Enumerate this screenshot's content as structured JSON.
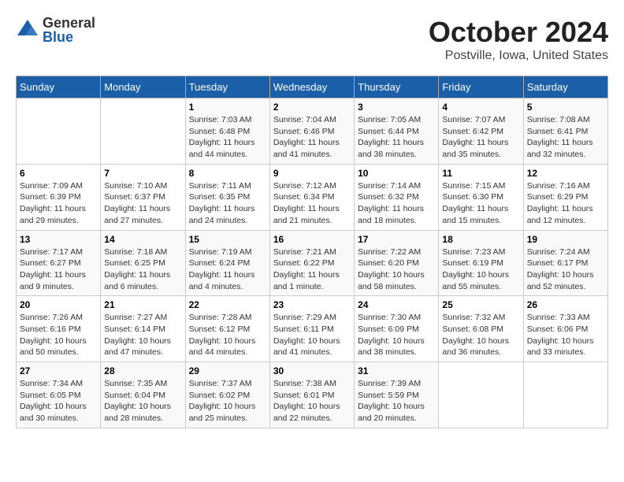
{
  "logo": {
    "general": "General",
    "blue": "Blue"
  },
  "title": "October 2024",
  "location": "Postville, Iowa, United States",
  "headers": [
    "Sunday",
    "Monday",
    "Tuesday",
    "Wednesday",
    "Thursday",
    "Friday",
    "Saturday"
  ],
  "weeks": [
    [
      {
        "day": null,
        "info": null
      },
      {
        "day": null,
        "info": null
      },
      {
        "day": "1",
        "info": "Sunrise: 7:03 AM\nSunset: 6:48 PM\nDaylight: 11 hours and 44 minutes."
      },
      {
        "day": "2",
        "info": "Sunrise: 7:04 AM\nSunset: 6:46 PM\nDaylight: 11 hours and 41 minutes."
      },
      {
        "day": "3",
        "info": "Sunrise: 7:05 AM\nSunset: 6:44 PM\nDaylight: 11 hours and 38 minutes."
      },
      {
        "day": "4",
        "info": "Sunrise: 7:07 AM\nSunset: 6:42 PM\nDaylight: 11 hours and 35 minutes."
      },
      {
        "day": "5",
        "info": "Sunrise: 7:08 AM\nSunset: 6:41 PM\nDaylight: 11 hours and 32 minutes."
      }
    ],
    [
      {
        "day": "6",
        "info": "Sunrise: 7:09 AM\nSunset: 6:39 PM\nDaylight: 11 hours and 29 minutes."
      },
      {
        "day": "7",
        "info": "Sunrise: 7:10 AM\nSunset: 6:37 PM\nDaylight: 11 hours and 27 minutes."
      },
      {
        "day": "8",
        "info": "Sunrise: 7:11 AM\nSunset: 6:35 PM\nDaylight: 11 hours and 24 minutes."
      },
      {
        "day": "9",
        "info": "Sunrise: 7:12 AM\nSunset: 6:34 PM\nDaylight: 11 hours and 21 minutes."
      },
      {
        "day": "10",
        "info": "Sunrise: 7:14 AM\nSunset: 6:32 PM\nDaylight: 11 hours and 18 minutes."
      },
      {
        "day": "11",
        "info": "Sunrise: 7:15 AM\nSunset: 6:30 PM\nDaylight: 11 hours and 15 minutes."
      },
      {
        "day": "12",
        "info": "Sunrise: 7:16 AM\nSunset: 6:29 PM\nDaylight: 11 hours and 12 minutes."
      }
    ],
    [
      {
        "day": "13",
        "info": "Sunrise: 7:17 AM\nSunset: 6:27 PM\nDaylight: 11 hours and 9 minutes."
      },
      {
        "day": "14",
        "info": "Sunrise: 7:18 AM\nSunset: 6:25 PM\nDaylight: 11 hours and 6 minutes."
      },
      {
        "day": "15",
        "info": "Sunrise: 7:19 AM\nSunset: 6:24 PM\nDaylight: 11 hours and 4 minutes."
      },
      {
        "day": "16",
        "info": "Sunrise: 7:21 AM\nSunset: 6:22 PM\nDaylight: 11 hours and 1 minute."
      },
      {
        "day": "17",
        "info": "Sunrise: 7:22 AM\nSunset: 6:20 PM\nDaylight: 10 hours and 58 minutes."
      },
      {
        "day": "18",
        "info": "Sunrise: 7:23 AM\nSunset: 6:19 PM\nDaylight: 10 hours and 55 minutes."
      },
      {
        "day": "19",
        "info": "Sunrise: 7:24 AM\nSunset: 6:17 PM\nDaylight: 10 hours and 52 minutes."
      }
    ],
    [
      {
        "day": "20",
        "info": "Sunrise: 7:26 AM\nSunset: 6:16 PM\nDaylight: 10 hours and 50 minutes."
      },
      {
        "day": "21",
        "info": "Sunrise: 7:27 AM\nSunset: 6:14 PM\nDaylight: 10 hours and 47 minutes."
      },
      {
        "day": "22",
        "info": "Sunrise: 7:28 AM\nSunset: 6:12 PM\nDaylight: 10 hours and 44 minutes."
      },
      {
        "day": "23",
        "info": "Sunrise: 7:29 AM\nSunset: 6:11 PM\nDaylight: 10 hours and 41 minutes."
      },
      {
        "day": "24",
        "info": "Sunrise: 7:30 AM\nSunset: 6:09 PM\nDaylight: 10 hours and 38 minutes."
      },
      {
        "day": "25",
        "info": "Sunrise: 7:32 AM\nSunset: 6:08 PM\nDaylight: 10 hours and 36 minutes."
      },
      {
        "day": "26",
        "info": "Sunrise: 7:33 AM\nSunset: 6:06 PM\nDaylight: 10 hours and 33 minutes."
      }
    ],
    [
      {
        "day": "27",
        "info": "Sunrise: 7:34 AM\nSunset: 6:05 PM\nDaylight: 10 hours and 30 minutes."
      },
      {
        "day": "28",
        "info": "Sunrise: 7:35 AM\nSunset: 6:04 PM\nDaylight: 10 hours and 28 minutes."
      },
      {
        "day": "29",
        "info": "Sunrise: 7:37 AM\nSunset: 6:02 PM\nDaylight: 10 hours and 25 minutes."
      },
      {
        "day": "30",
        "info": "Sunrise: 7:38 AM\nSunset: 6:01 PM\nDaylight: 10 hours and 22 minutes."
      },
      {
        "day": "31",
        "info": "Sunrise: 7:39 AM\nSunset: 5:59 PM\nDaylight: 10 hours and 20 minutes."
      },
      {
        "day": null,
        "info": null
      },
      {
        "day": null,
        "info": null
      }
    ]
  ]
}
